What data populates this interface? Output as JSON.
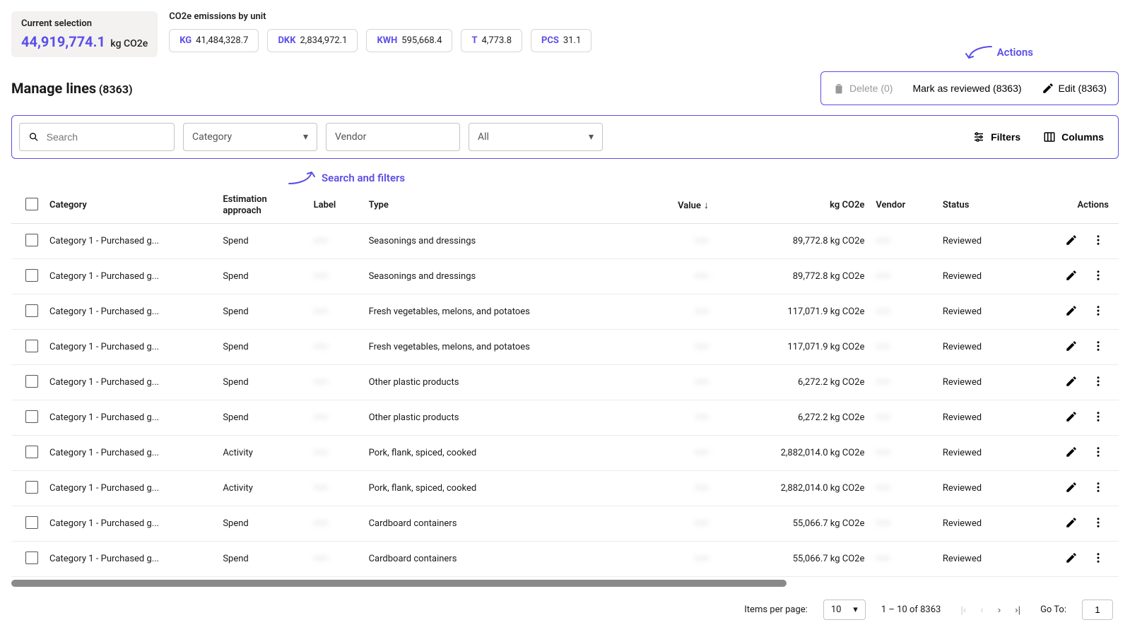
{
  "selection": {
    "label": "Current selection",
    "value": "44,919,774.1",
    "unit": "kg CO2e"
  },
  "unitsTitle": "CO2e emissions by unit",
  "units": [
    {
      "code": "KG",
      "value": "41,484,328.7"
    },
    {
      "code": "DKK",
      "value": "2,834,972.1"
    },
    {
      "code": "KWH",
      "value": "595,668.4"
    },
    {
      "code": "T",
      "value": "4,773.8"
    },
    {
      "code": "PCS",
      "value": "31.1"
    }
  ],
  "pageTitle": "Manage lines",
  "totalCount": "(8363)",
  "actions": {
    "delete": "Delete (0)",
    "review": "Mark as reviewed (8363)",
    "edit": "Edit (8363)"
  },
  "annotations": {
    "actions": "Actions",
    "filters": "Search and filters"
  },
  "filters": {
    "searchPlaceholder": "Search",
    "categoryPlaceholder": "Category",
    "vendorPlaceholder": "Vendor",
    "statusSelected": "All",
    "filtersBtn": "Filters",
    "columnsBtn": "Columns"
  },
  "columns": {
    "category": "Category",
    "estimation": "Estimation approach",
    "label": "Label",
    "type": "Type",
    "value": "Value",
    "co2e": "kg CO2e",
    "vendor": "Vendor",
    "status": "Status",
    "actions": "Actions"
  },
  "rows": [
    {
      "category": "Category 1 - Purchased g...",
      "estimation": "Spend",
      "label": "——",
      "type": "Seasonings and dressings",
      "value": "——",
      "co2e": "89,772.8 kg CO2e",
      "vendor": "——",
      "status": "Reviewed"
    },
    {
      "category": "Category 1 - Purchased g...",
      "estimation": "Spend",
      "label": "——",
      "type": "Seasonings and dressings",
      "value": "——",
      "co2e": "89,772.8 kg CO2e",
      "vendor": "——",
      "status": "Reviewed"
    },
    {
      "category": "Category 1 - Purchased g...",
      "estimation": "Spend",
      "label": "——",
      "type": "Fresh vegetables, melons, and potatoes",
      "value": "——",
      "co2e": "117,071.9 kg CO2e",
      "vendor": "——",
      "status": "Reviewed"
    },
    {
      "category": "Category 1 - Purchased g...",
      "estimation": "Spend",
      "label": "——",
      "type": "Fresh vegetables, melons, and potatoes",
      "value": "——",
      "co2e": "117,071.9 kg CO2e",
      "vendor": "——",
      "status": "Reviewed"
    },
    {
      "category": "Category 1 - Purchased g...",
      "estimation": "Spend",
      "label": "——",
      "type": "Other plastic products",
      "value": "——",
      "co2e": "6,272.2 kg CO2e",
      "vendor": "——",
      "status": "Reviewed"
    },
    {
      "category": "Category 1 - Purchased g...",
      "estimation": "Spend",
      "label": "——",
      "type": "Other plastic products",
      "value": "——",
      "co2e": "6,272.2 kg CO2e",
      "vendor": "——",
      "status": "Reviewed"
    },
    {
      "category": "Category 1 - Purchased g...",
      "estimation": "Activity",
      "label": "——",
      "type": "Pork, flank, spiced, cooked",
      "value": "——",
      "co2e": "2,882,014.0 kg CO2e",
      "vendor": "——",
      "status": "Reviewed"
    },
    {
      "category": "Category 1 - Purchased g...",
      "estimation": "Activity",
      "label": "——",
      "type": "Pork, flank, spiced, cooked",
      "value": "——",
      "co2e": "2,882,014.0 kg CO2e",
      "vendor": "——",
      "status": "Reviewed"
    },
    {
      "category": "Category 1 - Purchased g...",
      "estimation": "Spend",
      "label": "——",
      "type": "Cardboard containers",
      "value": "——",
      "co2e": "55,066.7 kg CO2e",
      "vendor": "——",
      "status": "Reviewed"
    },
    {
      "category": "Category 1 - Purchased g...",
      "estimation": "Spend",
      "label": "——",
      "type": "Cardboard containers",
      "value": "——",
      "co2e": "55,066.7 kg CO2e",
      "vendor": "——",
      "status": "Reviewed"
    }
  ],
  "pagination": {
    "itemsLabel": "Items per page:",
    "perPage": "10",
    "range": "1 – 10 of 8363",
    "gotoLabel": "Go To:",
    "gotoValue": "1"
  }
}
